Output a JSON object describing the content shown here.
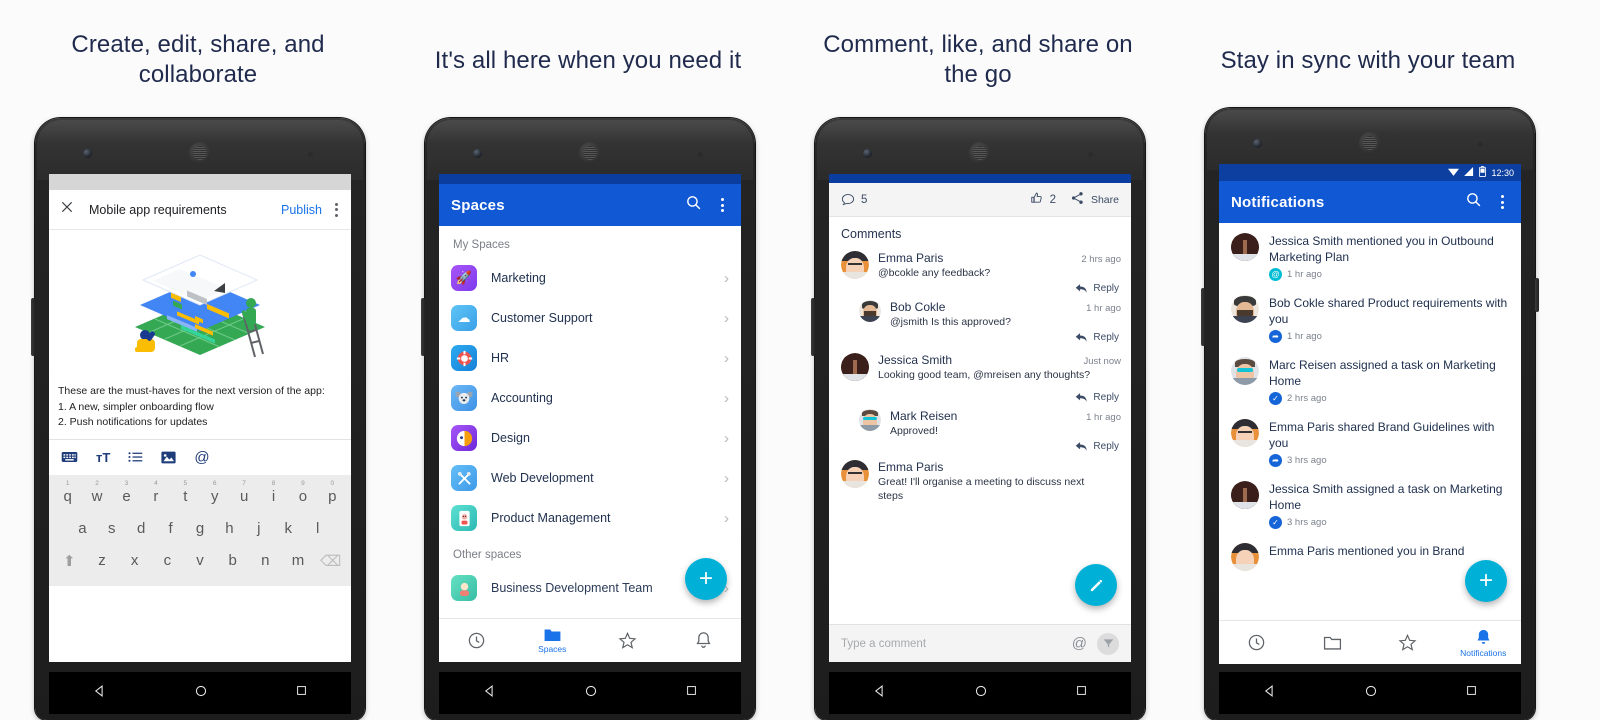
{
  "panels": [
    {
      "heading": "Create, edit, share, and collaborate"
    },
    {
      "heading": "It's all here when you need it"
    },
    {
      "heading": "Comment, like, and share on the go"
    },
    {
      "heading": "Stay in sync with your team"
    }
  ],
  "colors": {
    "appbar_blue": "#1158d4",
    "statusbar_blue": "#0d3fa0",
    "fab_cyan": "#00b0d7",
    "link_blue": "#1a73e8",
    "heading_navy": "#1f2a4d"
  },
  "doc_screen": {
    "close_label": "✕",
    "title": "Mobile app requirements",
    "publish_label": "Publish",
    "overflow_label": "more-options",
    "body_lines": [
      "These are the must-haves for the next version of the app:",
      "1. A new, simpler onboarding flow",
      "2. Push notifications for updates"
    ],
    "toolbar_icons": [
      "keyboard-icon",
      "text-format-icon",
      "bullet-list-icon",
      "image-icon",
      "mention-icon"
    ],
    "keyboard": {
      "row1": [
        "q",
        "w",
        "e",
        "r",
        "t",
        "y",
        "u",
        "i",
        "o",
        "p"
      ],
      "row1_numbers": [
        "1",
        "2",
        "3",
        "4",
        "5",
        "6",
        "7",
        "8",
        "9",
        "0"
      ],
      "row2": [
        "a",
        "s",
        "d",
        "f",
        "g",
        "h",
        "j",
        "k",
        "l"
      ],
      "row3": [
        "z",
        "x",
        "c",
        "v",
        "b",
        "n",
        "m"
      ],
      "shift_label": "⬆",
      "backspace_label": "⌫"
    }
  },
  "spaces_screen": {
    "appbar_title": "Spaces",
    "search_label": "search",
    "overflow_label": "more-options",
    "section_my": "My Spaces",
    "section_other": "Other spaces",
    "items": [
      {
        "name": "Marketing",
        "icon": "rocket",
        "glyph": "🚀",
        "color": "#9b4ddb"
      },
      {
        "name": "Customer Support",
        "icon": "cloud",
        "glyph": "☁",
        "color": "#45b6f2"
      },
      {
        "name": "HR",
        "icon": "lifebuoy",
        "glyph": "⭕",
        "color": "#1aa3e8"
      },
      {
        "name": "Accounting",
        "icon": "koala",
        "glyph": "🐨",
        "color": "#4fa8ef"
      },
      {
        "name": "Design",
        "icon": "palette",
        "glyph": "◑",
        "color": "#7d3fd1"
      },
      {
        "name": "Web Development",
        "icon": "tools",
        "glyph": "✂",
        "color": "#53b5f0"
      },
      {
        "name": "Product Management",
        "icon": "phone-person",
        "glyph": "📱",
        "color": "#4ad0c8"
      }
    ],
    "other_item": {
      "name": "Business Development Team",
      "color": "#4ad0b0"
    },
    "bottom_nav": [
      {
        "label": "",
        "icon": "recent-clock-icon",
        "active": false
      },
      {
        "label": "Spaces",
        "icon": "folder-icon",
        "active": true
      },
      {
        "label": "",
        "icon": "star-icon",
        "active": false
      },
      {
        "label": "",
        "icon": "bell-icon",
        "active": false
      }
    ],
    "fab_label": "+"
  },
  "comments_screen": {
    "comment_count": "5",
    "like_count": "2",
    "share_label": "Share",
    "section_title": "Comments",
    "reply_label": "Reply",
    "comments": [
      {
        "name": "Emma Paris",
        "time": "2 hrs ago",
        "text": "@bcokle  any feedback?",
        "reply": false,
        "avatar": "emma"
      },
      {
        "name": "Bob Cokle",
        "time": "1 hr ago",
        "text": "@jsmith  Is this approved?",
        "reply": true,
        "avatar": "bob"
      },
      {
        "name": "Jessica Smith",
        "time": "Just now",
        "text": "Looking good team, @mreisen any thoughts?",
        "reply": false,
        "avatar": "jessica"
      },
      {
        "name": "Mark Reisen",
        "time": "1 hr ago",
        "text": "Approved!",
        "reply": true,
        "avatar": "marc"
      },
      {
        "name": "Emma Paris",
        "time": "",
        "text": "Great! I'll organise a meeting to discuss next steps",
        "reply": false,
        "avatar": "emma"
      }
    ],
    "input_placeholder": "Type a comment",
    "mention_label": "@",
    "send_label": "send",
    "fab_label": "edit"
  },
  "notifications_screen": {
    "status_time": "12:30",
    "appbar_title": "Notifications",
    "search_label": "search",
    "overflow_label": "more-options",
    "items": [
      {
        "actor": "Jessica Smith",
        "action": " mentioned you in ",
        "object": "Outbound Marketing Plan",
        "time": "1 hr ago",
        "badge": "mention",
        "badge_color": "#00bcd4",
        "avatar": "jessica"
      },
      {
        "actor": "Bob Cokle",
        "action": " shared ",
        "object": "Product requirements",
        "tail": " with you",
        "time": "1 hr ago",
        "badge": "share",
        "badge_color": "#1565d8",
        "avatar": "bob"
      },
      {
        "actor": "Marc Reisen",
        "action": " assigned a task on ",
        "object": "Marketing Home",
        "time": "2 hrs ago",
        "badge": "task",
        "badge_color": "#1565d8",
        "avatar": "marc"
      },
      {
        "actor": "Emma Paris",
        "action": " shared ",
        "object": "Brand Guidelines",
        "tail": " with you",
        "time": "3 hrs ago",
        "badge": "share",
        "badge_color": "#1565d8",
        "avatar": "emma"
      },
      {
        "actor": "Jessica Smith",
        "action": " assigned a task on ",
        "object": "Marketing Home",
        "time": "3 hrs ago",
        "badge": "task",
        "badge_color": "#1565d8",
        "avatar": "jessica"
      },
      {
        "actor": "Emma Paris",
        "action": " mentioned you in ",
        "object": "Brand",
        "time": "",
        "badge": "",
        "badge_color": "",
        "avatar": "emma"
      }
    ],
    "bottom_nav": [
      {
        "label": "",
        "icon": "recent-clock-icon",
        "active": false
      },
      {
        "label": "",
        "icon": "folder-icon",
        "active": false
      },
      {
        "label": "",
        "icon": "star-icon",
        "active": false
      },
      {
        "label": "Notifications",
        "icon": "bell-icon",
        "active": true
      }
    ],
    "fab_label": "+"
  },
  "system_nav": {
    "back": "back-triangle",
    "home": "home-circle",
    "recents": "recents-square"
  }
}
